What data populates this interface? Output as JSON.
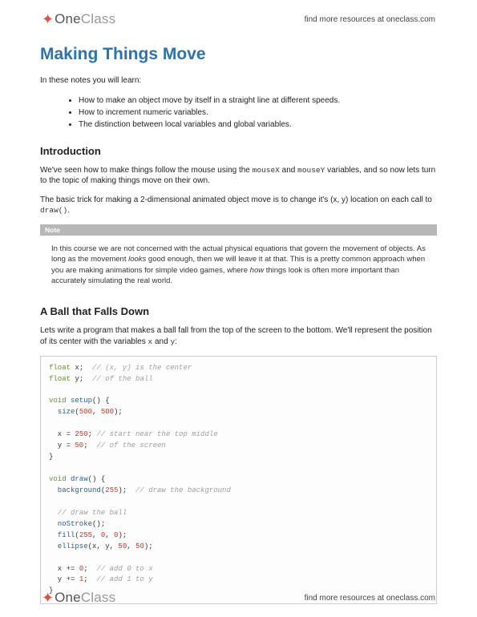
{
  "brand": {
    "one": "One",
    "class": "Class"
  },
  "find_link": "find more resources at oneclass.com",
  "title": "Making Things Move",
  "intro_lead": "In these notes you will learn:",
  "bullets": [
    "How to make an object move by itself in a straight line at different speeds.",
    "How to increment numeric variables.",
    "The distinction between local variables and global variables."
  ],
  "sections": {
    "intro_heading": "Introduction",
    "intro_p1a": "We've seen how to make things follow the mouse using the ",
    "intro_p1_code1": "mouseX",
    "intro_p1b": " and ",
    "intro_p1_code2": "mouseY",
    "intro_p1c": " variables, and so now lets turn to the topic of making things move on their own.",
    "intro_p2a": "The basic trick for making a 2-dimensional animated object move is to change it's (x, y) location on each call to ",
    "intro_p2_code": "draw()",
    "intro_p2b": ".",
    "note_label": "Note",
    "note_body_a": "In this course we are not concerned with the actual physical equations that govern the movement of objects. As long as the movement ",
    "note_body_em1": "looks",
    "note_body_b": " good enough, then we will leave it at that. This is a pretty common approach when you are making animations for simple video games, where ",
    "note_body_em2": "how",
    "note_body_c": " things look is often more important than accurately simulating the real world.",
    "ball_heading": "A Ball that Falls Down",
    "ball_p1a": "Lets write a program that makes a ball fall from the top of the screen to the bottom. We'll represent the position of its center with the variables ",
    "ball_p1_code1": "x",
    "ball_p1b": " and ",
    "ball_p1_code2": "y",
    "ball_p1c": ":"
  },
  "code": {
    "l1_type": "float",
    "l1_var": " x;  ",
    "l1_com": "// (x, y) is the center",
    "l2_type": "float",
    "l2_var": " y;  ",
    "l2_com": "// of the ball",
    "l4_kw": "void",
    "l4_fn": " setup",
    "l4_rest": "() {",
    "l5_fn": "  size",
    "l5_open": "(",
    "l5_n1": "500",
    "l5_comma": ", ",
    "l5_n2": "500",
    "l5_close": ");",
    "l7_a": "  x = ",
    "l7_n": "250",
    "l7_b": "; ",
    "l7_com": "// start near the top middle",
    "l8_a": "  y = ",
    "l8_n": "50",
    "l8_b": ";  ",
    "l8_com": "// of the screen",
    "l9": "}",
    "l11_kw": "void",
    "l11_fn": " draw",
    "l11_rest": "() {",
    "l12_fn": "  background",
    "l12_open": "(",
    "l12_n": "255",
    "l12_close": ");  ",
    "l12_com": "// draw the background",
    "l14_com": "  // draw the ball",
    "l15_fn": "  noStroke",
    "l15_rest": "();",
    "l16_fn": "  fill",
    "l16_open": "(",
    "l16_n1": "255",
    "l16_c1": ", ",
    "l16_n2": "0",
    "l16_c2": ", ",
    "l16_n3": "0",
    "l16_close": ");",
    "l17_fn": "  ellipse",
    "l17_open": "(x, y, ",
    "l17_n1": "50",
    "l17_c": ", ",
    "l17_n2": "50",
    "l17_close": ");",
    "l19_a": "  x += ",
    "l19_n": "0",
    "l19_b": ";  ",
    "l19_com": "// add 0 to x",
    "l20_a": "  y += ",
    "l20_n": "1",
    "l20_b": ";  ",
    "l20_com": "// add 1 to y",
    "l21": "}"
  }
}
